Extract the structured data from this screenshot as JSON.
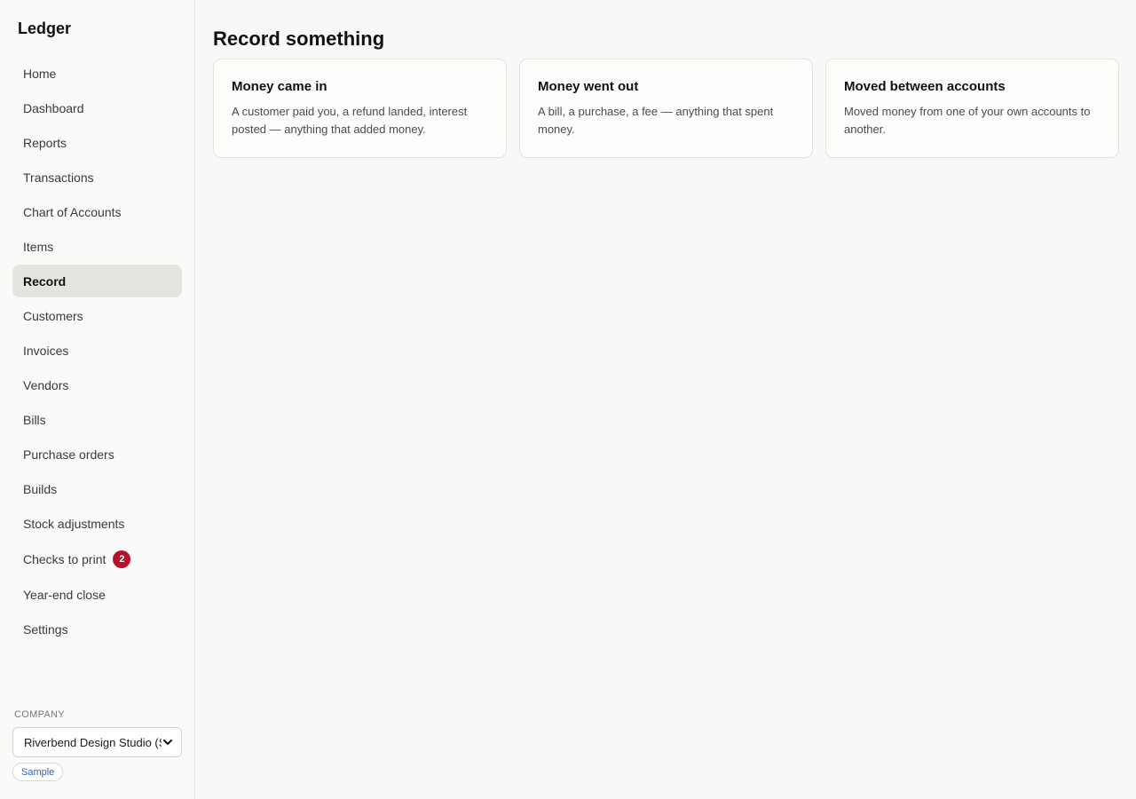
{
  "app": {
    "title": "Ledger"
  },
  "sidebar": {
    "items": [
      {
        "label": "Home"
      },
      {
        "label": "Dashboard"
      },
      {
        "label": "Reports"
      },
      {
        "label": "Transactions"
      },
      {
        "label": "Chart of Accounts"
      },
      {
        "label": "Items"
      },
      {
        "label": "Record",
        "active": true
      },
      {
        "label": "Customers"
      },
      {
        "label": "Invoices"
      },
      {
        "label": "Vendors"
      },
      {
        "label": "Bills"
      },
      {
        "label": "Purchase orders"
      },
      {
        "label": "Builds"
      },
      {
        "label": "Stock adjustments"
      },
      {
        "label": "Checks to print",
        "badge": "2"
      },
      {
        "label": "Year-end close"
      },
      {
        "label": "Settings"
      }
    ],
    "company": {
      "label": "COMPANY",
      "selected": "Riverbend Design Studio (S",
      "tag": "Sample"
    }
  },
  "main": {
    "title": "Record something",
    "cards": [
      {
        "title": "Money came in",
        "description": "A customer paid you, a refund landed, interest posted — anything that added money."
      },
      {
        "title": "Money went out",
        "description": "A bill, a purchase, a fee — anything that spent money."
      },
      {
        "title": "Moved between accounts",
        "description": "Moved money from one of your own accounts to another."
      }
    ]
  },
  "colors": {
    "badge": "#b5122a",
    "active_nav_bg": "#e4e4e1",
    "sample_tag_text": "#2f62b8"
  },
  "icons": {
    "company_select": "chevron-down-icon"
  }
}
